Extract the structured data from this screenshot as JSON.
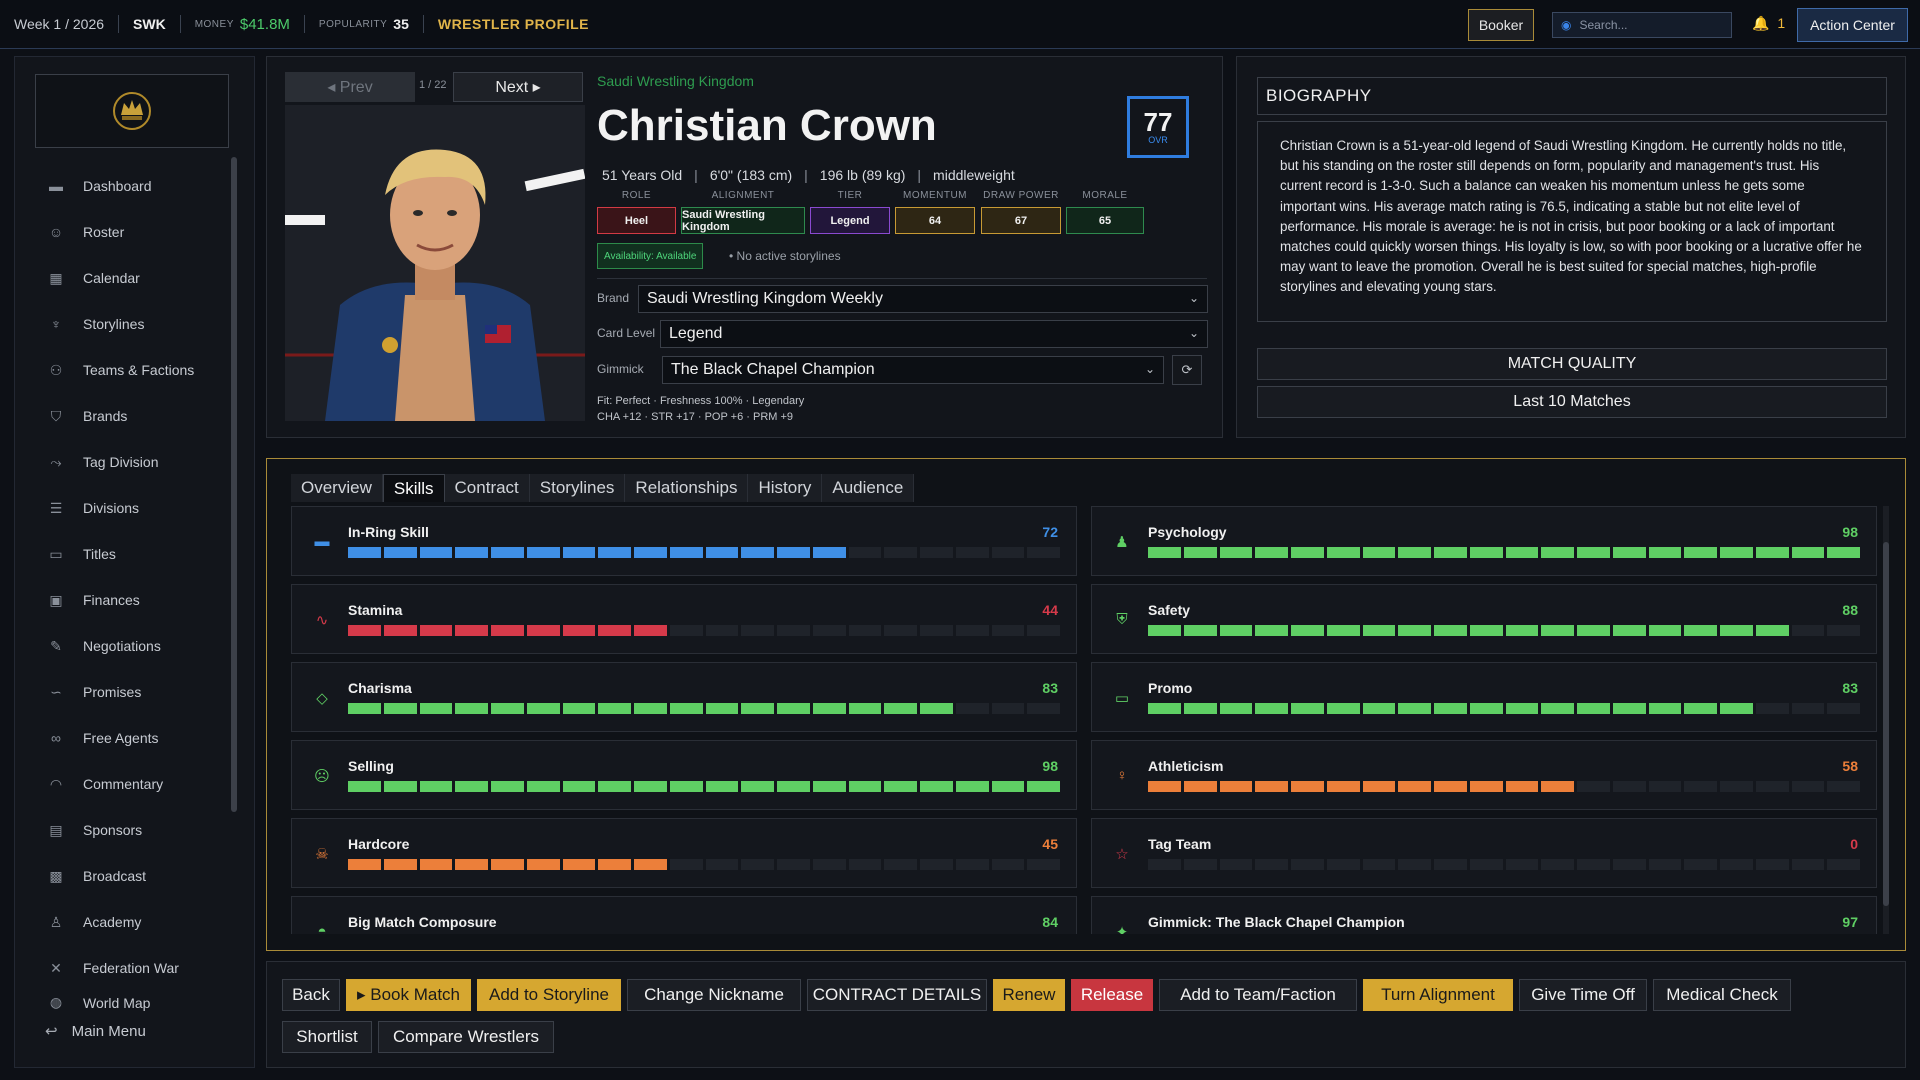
{
  "topbar": {
    "week": "Week 1 / 2026",
    "federation": "SWK",
    "money_label": "MONEY",
    "money_value": "$41.8M",
    "popularity_label": "POPULARITY",
    "popularity_value": "35",
    "screen_title": "WRESTLER PROFILE",
    "booker_label": "Booker",
    "search_placeholder": "Search...",
    "notifications": "1",
    "action_center_label": "Action Center"
  },
  "sidebar": {
    "items": [
      {
        "label": "Dashboard",
        "icon": "dashboard-icon"
      },
      {
        "label": "Roster",
        "icon": "roster-icon"
      },
      {
        "label": "Calendar",
        "icon": "calendar-icon"
      },
      {
        "label": "Storylines",
        "icon": "storylines-icon"
      },
      {
        "label": "Teams & Factions",
        "icon": "teams-icon"
      },
      {
        "label": "Brands",
        "icon": "brands-icon"
      },
      {
        "label": "Tag Division",
        "icon": "tag-division-icon"
      },
      {
        "label": "Divisions",
        "icon": "divisions-icon"
      },
      {
        "label": "Titles",
        "icon": "titles-icon"
      },
      {
        "label": "Finances",
        "icon": "finances-icon"
      },
      {
        "label": "Negotiations",
        "icon": "negotiations-icon"
      },
      {
        "label": "Promises",
        "icon": "promises-icon"
      },
      {
        "label": "Free Agents",
        "icon": "free-agents-icon"
      },
      {
        "label": "Commentary",
        "icon": "commentary-icon"
      },
      {
        "label": "Sponsors",
        "icon": "sponsors-icon"
      },
      {
        "label": "Broadcast",
        "icon": "broadcast-icon"
      },
      {
        "label": "Academy",
        "icon": "academy-icon"
      },
      {
        "label": "Federation War",
        "icon": "federation-war-icon"
      },
      {
        "label": "World Map",
        "icon": "world-map-icon"
      }
    ],
    "main_menu_label": "Main Menu"
  },
  "profile": {
    "prev_label": "◂ Prev",
    "next_label": "Next ▸",
    "pager": "1 / 22",
    "federation": "Saudi Wrestling Kingdom",
    "name": "Christian Crown",
    "ovr_value": "77",
    "ovr_label": "OVR",
    "age": "51 Years Old",
    "height": "6'0\" (183 cm)",
    "weight": "196 lb (89 kg)",
    "division": "middleweight",
    "stats": [
      {
        "label": "ROLE",
        "value": "Heel",
        "color": "#d23a44",
        "bg": "#3a1418"
      },
      {
        "label": "ALIGNMENT",
        "value": "Saudi Wrestling Kingdom",
        "color": "#2e8a4e",
        "bg": "#10261a"
      },
      {
        "label": "TIER",
        "value": "Legend",
        "color": "#8a4ad0",
        "bg": "#22163a"
      },
      {
        "label": "MOMENTUM",
        "value": "64",
        "color": "#c79a34",
        "bg": "#2e2614"
      },
      {
        "label": "DRAW POWER",
        "value": "67",
        "color": "#c79a34",
        "bg": "#2e2614"
      },
      {
        "label": "MORALE",
        "value": "65",
        "color": "#2e8a4e",
        "bg": "#10261a"
      }
    ],
    "availability": "Availability: Available",
    "storylines_status": "• No active storylines",
    "brand_label": "Brand",
    "brand_value": "Saudi Wrestling Kingdom Weekly",
    "card_level_label": "Card Level",
    "card_level_value": "Legend",
    "gimmick_label": "Gimmick",
    "gimmick_value": "The Black Chapel Champion",
    "fit_line": "Fit: Perfect · Freshness 100% · Legendary",
    "bonus_line": "CHA +12 · STR +17 · POP +6 · PRM +9"
  },
  "biography": {
    "title": "BIOGRAPHY",
    "text": "Christian Crown is a 51-year-old legend of Saudi Wrestling Kingdom. He currently holds no title, but his standing on the roster still depends on form, popularity and management's trust. His current record is 1-3-0. Such a balance can weaken his momentum unless he gets some important wins. His average match rating is 76.5, indicating a stable but not elite level of performance. His morale is average: he is not in crisis, but poor booking or a lack of important matches could quickly worsen things. His loyalty is low, so with poor booking or a lucrative offer he may want to leave the promotion. Overall he is best suited for special matches, high-profile storylines and elevating young stars.",
    "match_quality_label": "MATCH QUALITY",
    "last_matches_label": "Last 10 Matches"
  },
  "tabs": [
    "Overview",
    "Skills",
    "Contract",
    "Storylines",
    "Relationships",
    "History",
    "Audience"
  ],
  "active_tab": "Skills",
  "skills": [
    {
      "name": "In-Ring Skill",
      "value": 72,
      "color": "#3f8fe6",
      "icon": "in-ring-icon"
    },
    {
      "name": "Psychology",
      "value": 98,
      "color": "#5fcf64",
      "icon": "psychology-icon"
    },
    {
      "name": "Stamina",
      "value": 44,
      "color": "#d63a4a",
      "icon": "stamina-icon"
    },
    {
      "name": "Safety",
      "value": 88,
      "color": "#5fcf64",
      "icon": "safety-icon"
    },
    {
      "name": "Charisma",
      "value": 83,
      "color": "#5fcf64",
      "icon": "charisma-icon"
    },
    {
      "name": "Promo",
      "value": 83,
      "color": "#5fcf64",
      "icon": "promo-icon"
    },
    {
      "name": "Selling",
      "value": 98,
      "color": "#5fcf64",
      "icon": "selling-icon"
    },
    {
      "name": "Athleticism",
      "value": 58,
      "color": "#ec7f3a",
      "icon": "athleticism-icon"
    },
    {
      "name": "Hardcore",
      "value": 45,
      "color": "#ec7f3a",
      "icon": "hardcore-icon"
    },
    {
      "name": "Tag Team",
      "value": 0,
      "color": "#d63a4a",
      "icon": "tag-team-icon"
    },
    {
      "name": "Big Match Composure",
      "value": 84,
      "color": "#5fcf64",
      "icon": "big-match-icon"
    },
    {
      "name": "Gimmick: The Black Chapel Champion",
      "value": 97,
      "color": "#5fcf64",
      "icon": "gimmick-icon"
    }
  ],
  "actions": {
    "row1": [
      {
        "label": "Back",
        "style": "default"
      },
      {
        "label": "▸ Book Match",
        "style": "gold"
      },
      {
        "label": "Add to Storyline",
        "style": "gold"
      },
      {
        "label": "Change Nickname",
        "style": "default"
      },
      {
        "label": "CONTRACT DETAILS",
        "style": "default"
      },
      {
        "label": "Renew",
        "style": "gold"
      },
      {
        "label": "Release",
        "style": "red"
      },
      {
        "label": "Add to Team/Faction",
        "style": "default"
      },
      {
        "label": "Turn Alignment",
        "style": "gold"
      },
      {
        "label": "Give Time Off",
        "style": "default"
      },
      {
        "label": "Medical Check",
        "style": "default"
      }
    ],
    "row2": [
      {
        "label": "Shortlist",
        "style": "default"
      },
      {
        "label": "Compare Wrestlers",
        "style": "default"
      }
    ]
  }
}
